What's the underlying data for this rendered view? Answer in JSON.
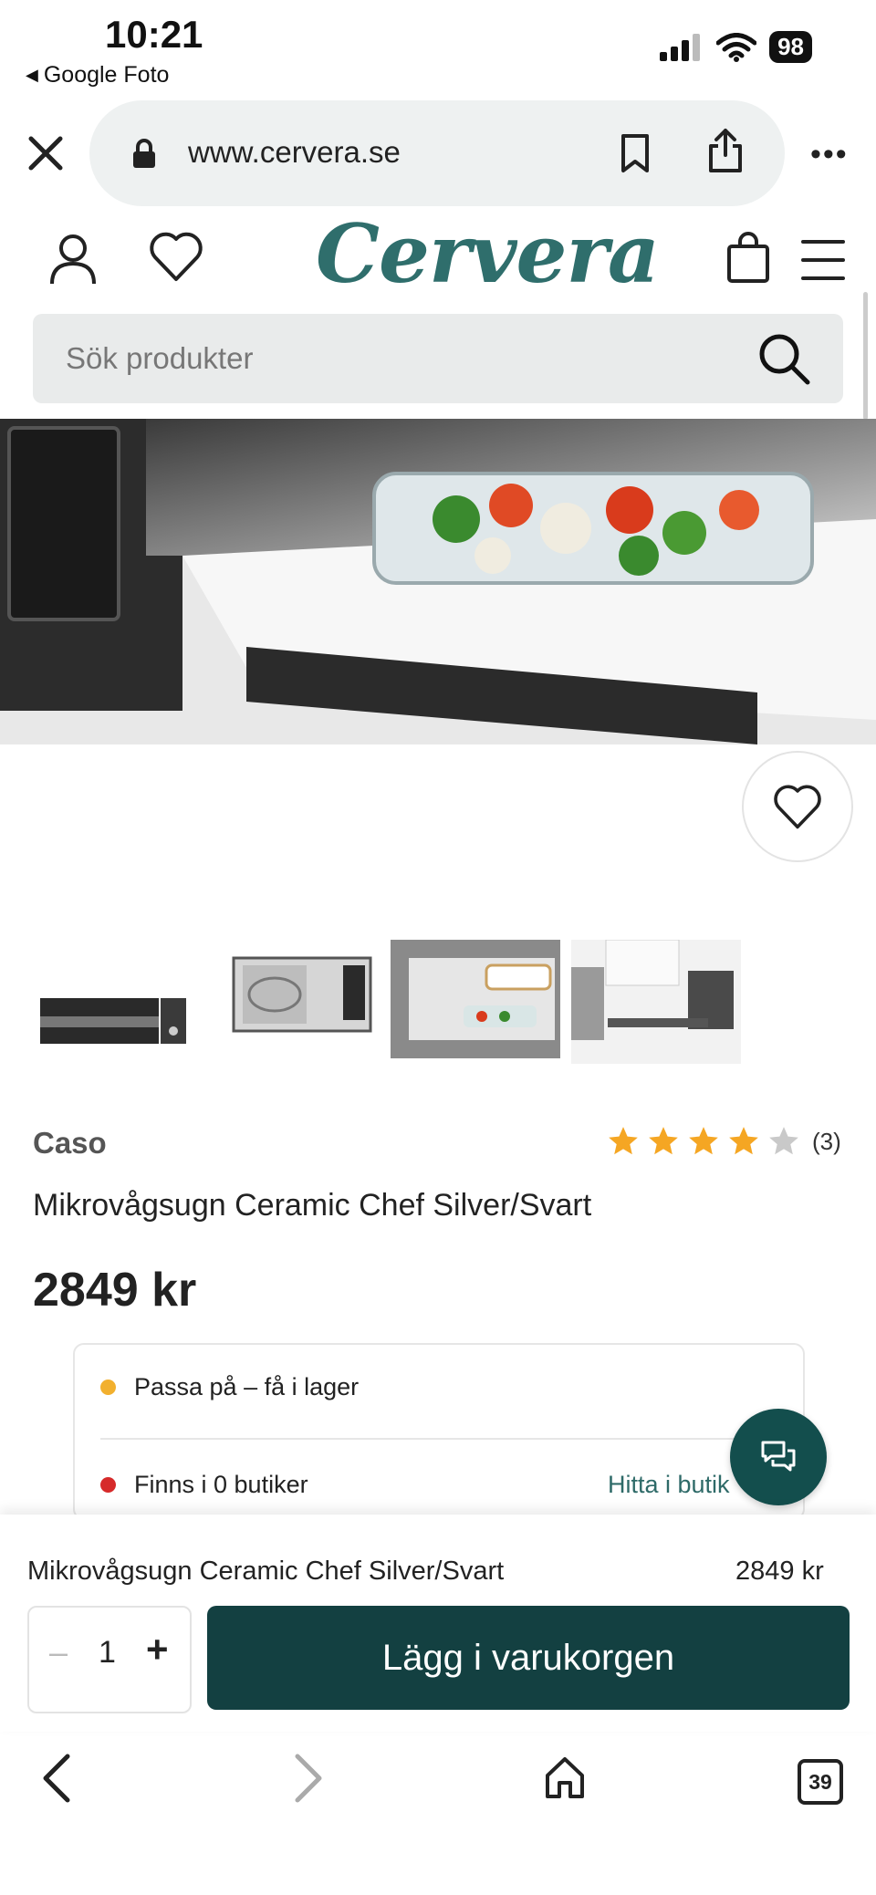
{
  "status_bar": {
    "time": "10:21",
    "back_app": "Google Foto",
    "battery": "98"
  },
  "browser": {
    "url": "www.cervera.se",
    "tabs_count": "39"
  },
  "site": {
    "logo": "Cervera",
    "search_placeholder": "Sök produkter"
  },
  "product": {
    "brand": "Caso",
    "rating": 4,
    "rating_max": 5,
    "review_count": "(3)",
    "name": "Mikrovågsugn Ceramic Chef Silver/Svart",
    "price": "2849 kr",
    "stock": {
      "online": "Passa på – få i lager",
      "online_color": "#f2b02e",
      "stores": "Finns i 0 butiker",
      "stores_color": "#d62a2a",
      "find_store": "Hitta i butik"
    },
    "thumbnails": [
      "microwave-front",
      "microwave-open",
      "microwave-with-dish",
      "kitchen-interior"
    ]
  },
  "sticky": {
    "name": "Mikrovågsugn Ceramic Chef Silver/Svart",
    "price": "2849 kr",
    "quantity_minus": "–",
    "quantity": "1",
    "quantity_plus": "+",
    "add_to_cart": "Lägg i varukorgen"
  },
  "colors": {
    "brand": "#2f6e6c",
    "button": "#134041",
    "chat": "#134e4d",
    "star": "#f5a623"
  }
}
